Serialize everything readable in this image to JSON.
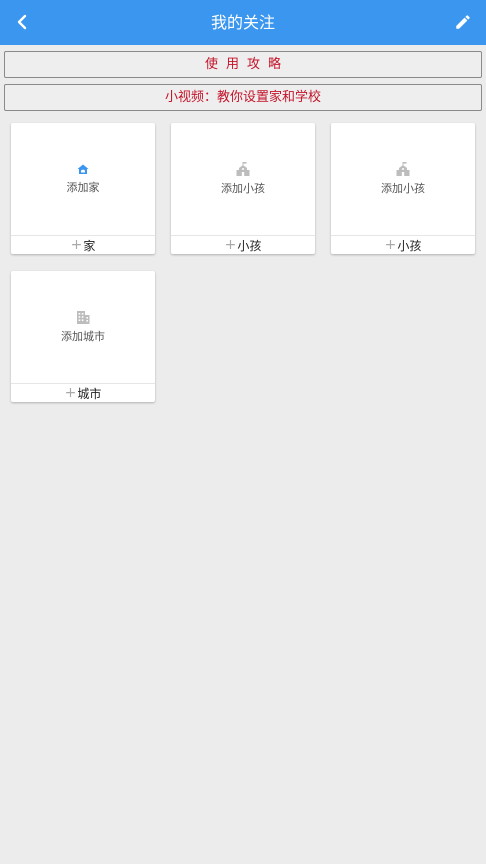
{
  "header": {
    "title": "我的关注",
    "back_icon": "chevron-left-icon",
    "edit_icon": "pencil-icon"
  },
  "buttons": {
    "guide_label": "使用攻略",
    "video_label": "小视频：教你设置家和学校"
  },
  "cards": [
    {
      "id": "home",
      "icon": "home-icon",
      "label": "添加家",
      "footer_plus": "+",
      "footer_label": "家",
      "icon_color": "#3a96ee"
    },
    {
      "id": "child1",
      "icon": "school-icon",
      "label": "添加小孩",
      "footer_plus": "+",
      "footer_label": "小孩",
      "icon_color": "#bdbdbd"
    },
    {
      "id": "child2",
      "icon": "school-icon",
      "label": "添加小孩",
      "footer_plus": "+",
      "footer_label": "小孩",
      "icon_color": "#bdbdbd"
    },
    {
      "id": "city",
      "icon": "building-icon",
      "label": "添加城市",
      "footer_plus": "+",
      "footer_label": "城市",
      "icon_color": "#bdbdbd"
    }
  ],
  "colors": {
    "header_bg": "#3a96ee",
    "button_text": "#c4132a",
    "page_bg": "#ececec"
  }
}
